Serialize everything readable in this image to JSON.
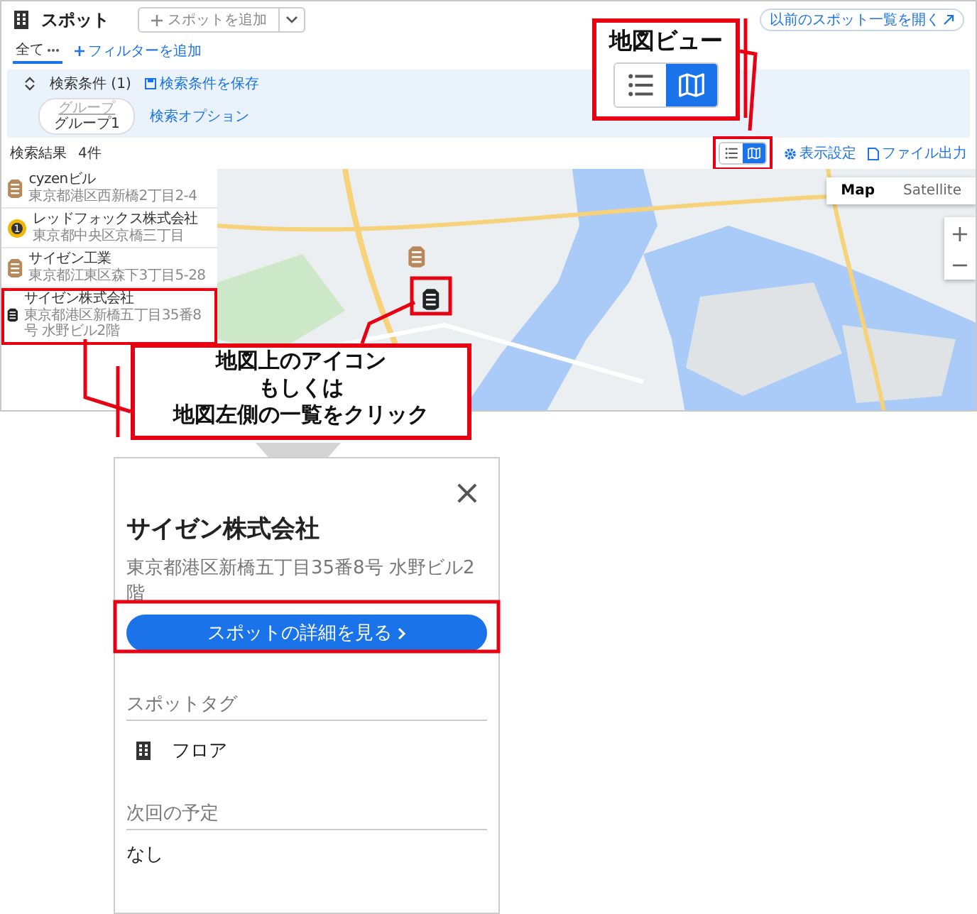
{
  "header": {
    "title": "スポット",
    "add_button": "スポットを追加",
    "legacy_link": "以前のスポット一覧を開く"
  },
  "filter_tabs": [
    {
      "label": "全て",
      "selected": true
    }
  ],
  "add_filter": "フィルターを追加",
  "search_panel": {
    "conditions": "検索条件 (1)",
    "save": "検索条件を保存",
    "chip": {
      "label": "グループ",
      "value": "グループ1"
    },
    "options": "検索オプション"
  },
  "results": {
    "count_label": "検索結果",
    "count": "4件",
    "display_settings": "表示設定",
    "export": "ファイル出力"
  },
  "view_modes": [
    {
      "kind": "list",
      "selected": false
    },
    {
      "kind": "map",
      "selected": true
    }
  ],
  "spots": [
    {
      "name": "cyzenビル",
      "address": "東京都港区西新橋2丁目2-4",
      "kind": "building",
      "color": "#b8875a",
      "selected": false
    },
    {
      "name": "レッドフォックス株式会社",
      "address": "東京都中央区京橋三丁目",
      "kind": "numbered",
      "number": "1",
      "color": "#f2b705",
      "selected": false
    },
    {
      "name": "サイゼン工業",
      "address": "東京都江東区森下3丁目5-28",
      "kind": "building",
      "color": "#b8875a",
      "selected": false
    },
    {
      "name": "サイゼン株式会社",
      "address": "東京都港区新橋五丁目35番8号 水野ビル2階",
      "kind": "building",
      "color": "#222222",
      "selected": true
    }
  ],
  "map": {
    "type_buttons": [
      {
        "label": "Map",
        "selected": true
      },
      {
        "label": "Satellite",
        "selected": false
      }
    ],
    "zoom_in": "+",
    "zoom_out": "−"
  },
  "callouts": {
    "view_title": "地図ビュー",
    "click_lines": [
      "地図上のアイコン",
      "もしくは",
      "地図左側の一覧をクリック"
    ]
  },
  "detail": {
    "close": "×",
    "title": "サイゼン株式会社",
    "address": "東京都港区新橋五丁目35番8号 水野ビル2階",
    "button": "スポットの詳細を見る",
    "tag_heading": "スポットタグ",
    "tags": [
      {
        "label": "フロア"
      }
    ],
    "schedule_heading": "次回の予定",
    "schedule": "なし"
  }
}
